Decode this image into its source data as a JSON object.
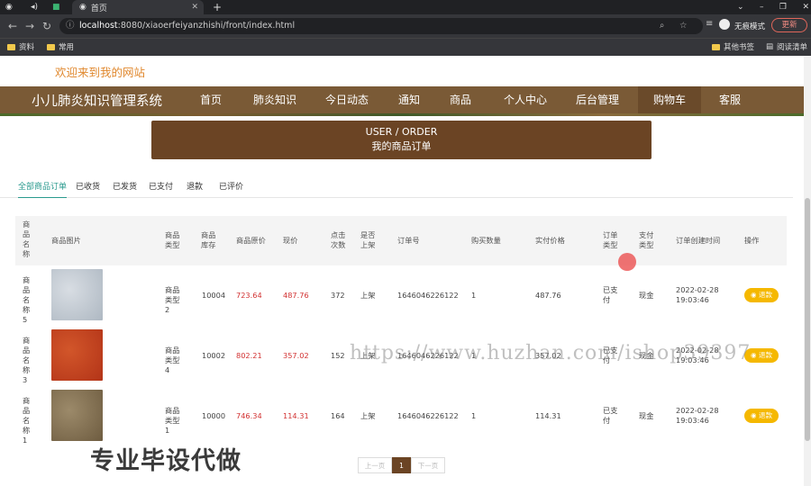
{
  "browser": {
    "tab_title": "首页",
    "url_host": "localhost",
    "url_rest": ":8080/xiaoerfeiyanzhishi/front/index.html",
    "incognito_label": "无痕模式",
    "update_label": "更新",
    "bookmarks": [
      "资料",
      "常用"
    ],
    "other_bookmarks": "其他书签",
    "reading_list": "阅读清单"
  },
  "site": {
    "welcome": "欢迎来到我的网站",
    "title": "小儿肺炎知识管理系统",
    "nav": [
      "首页",
      "肺炎知识",
      "今日动态",
      "通知",
      "商品",
      "个人中心",
      "后台管理",
      "购物车",
      "客服"
    ]
  },
  "banner": {
    "line1": "USER / ORDER",
    "line2": "我的商品订单"
  },
  "order_tabs": [
    "全部商品订单",
    "已收货",
    "已发货",
    "已支付",
    "退款",
    "已评价"
  ],
  "table": {
    "headers": [
      "商品名称",
      "商品图片",
      "商品类型",
      "商品库存",
      "商品原价",
      "现价",
      "点击次数",
      "是否上架",
      "订单号",
      "购买数量",
      "实付价格",
      "订单类型",
      "支付类型",
      "订单创建时间",
      "操作"
    ],
    "rows": [
      {
        "name": "商品名称5",
        "type": "商品类型2",
        "stock": "10004",
        "orig": "723.64",
        "price": "487.76",
        "clicks": "372",
        "onsale": "上架",
        "order_no": "1646046226122",
        "qty": "1",
        "paid": "487.76",
        "order_type": "已支付",
        "pay_type": "现金",
        "created": "2022-02-28 19:03:46",
        "action": "退款",
        "image_colors": [
          "#d8dde3",
          "#aeb8c2"
        ]
      },
      {
        "name": "商品名称3",
        "type": "商品类型4",
        "stock": "10002",
        "orig": "802.21",
        "price": "357.02",
        "clicks": "152",
        "onsale": "上架",
        "order_no": "1646046226122",
        "qty": "1",
        "paid": "357.02",
        "order_type": "已支付",
        "pay_type": "现金",
        "created": "2022-02-28 19:03:46",
        "action": "退款",
        "image_colors": [
          "#d2562a",
          "#b33418"
        ]
      },
      {
        "name": "商品名称1",
        "type": "商品类型1",
        "stock": "10000",
        "orig": "746.34",
        "price": "114.31",
        "clicks": "164",
        "onsale": "上架",
        "order_no": "1646046226122",
        "qty": "1",
        "paid": "114.31",
        "order_type": "已支付",
        "pay_type": "现金",
        "created": "2022-02-28 19:03:46",
        "action": "退款",
        "image_colors": [
          "#9c8a6a",
          "#6e5c40"
        ]
      }
    ]
  },
  "pager": {
    "prev": "上一页",
    "current": "1",
    "next": "下一页"
  },
  "overlay": {
    "caption": "专业毕设代做",
    "watermark": "https://www.huzhan.com/ishop39397"
  },
  "colors": {
    "nav_bg": "#7a5a36",
    "banner_bg": "#6b4424",
    "price": "#d23232",
    "refund": "#f5b800",
    "active_tab": "#2a9a8e"
  }
}
